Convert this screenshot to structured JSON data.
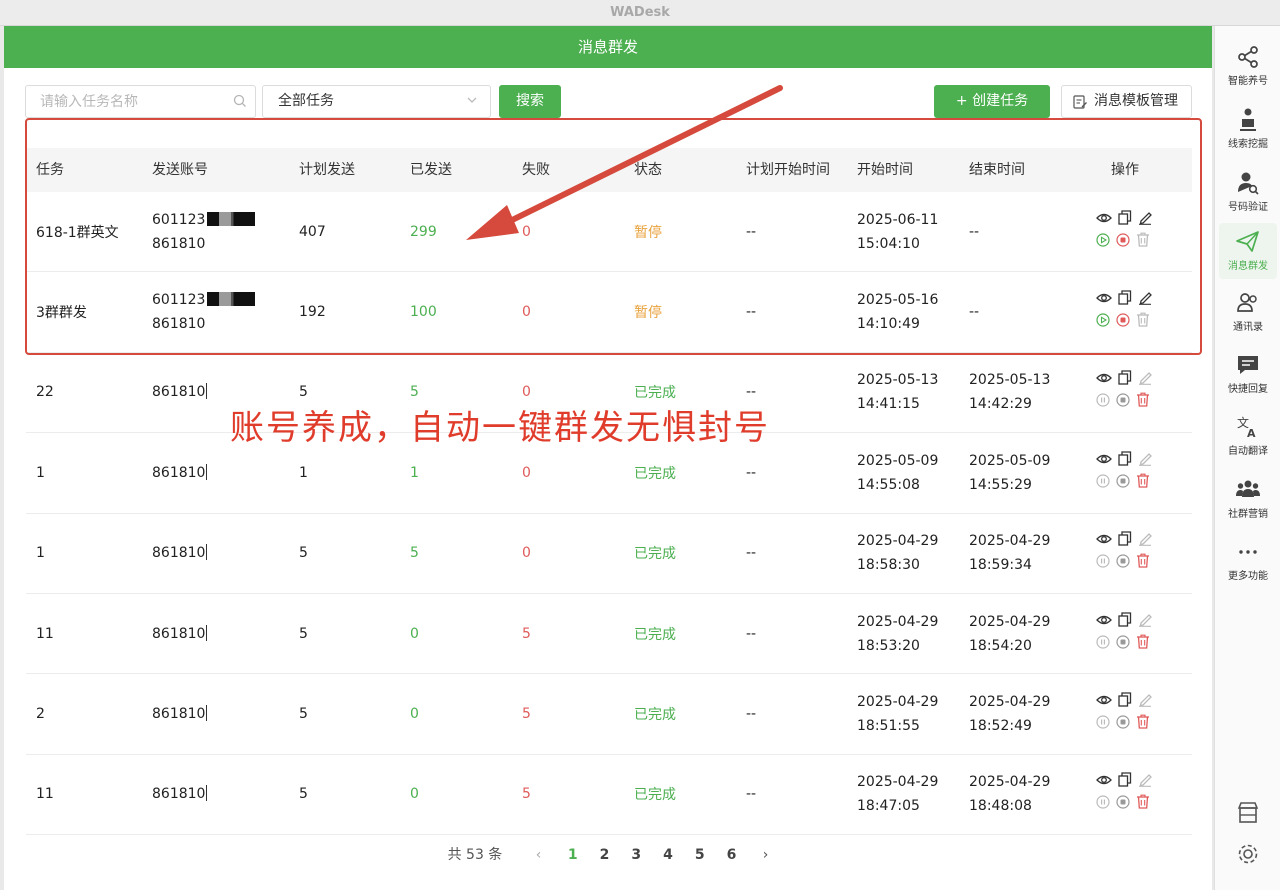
{
  "window": {
    "title": "WADesk"
  },
  "header": {
    "title": "消息群发"
  },
  "toolbar": {
    "search_placeholder": "请输入任务名称",
    "task_filter": "全部任务",
    "search_label": "搜索",
    "create_label": "+ 创建任务",
    "template_label": "消息模板管理"
  },
  "table": {
    "columns": [
      "任务",
      "发送账号",
      "计划发送",
      "已发送",
      "失败",
      "状态",
      "计划开始时间",
      "开始时间",
      "结束时间",
      "操作"
    ],
    "rows": [
      {
        "task": "618-1群英文",
        "account1": "601123",
        "account2": "861810",
        "planned": "407",
        "sent": "299",
        "failed": "0",
        "status": "暂停",
        "plan_start": "--",
        "start_date": "2025-06-11",
        "start_time": "15:04:10",
        "end_date": "--",
        "end_time": ""
      },
      {
        "task": "3群群发",
        "account1": "601123",
        "account2": "861810",
        "planned": "192",
        "sent": "100",
        "failed": "0",
        "status": "暂停",
        "plan_start": "--",
        "start_date": "2025-05-16",
        "start_time": "14:10:49",
        "end_date": "--",
        "end_time": ""
      },
      {
        "task": "22",
        "account1": "861810",
        "account2": "",
        "planned": "5",
        "sent": "5",
        "failed": "0",
        "status": "已完成",
        "plan_start": "--",
        "start_date": "2025-05-13",
        "start_time": "14:41:15",
        "end_date": "2025-05-13",
        "end_time": "14:42:29"
      },
      {
        "task": "1",
        "account1": "861810",
        "account2": "",
        "planned": "1",
        "sent": "1",
        "failed": "0",
        "status": "已完成",
        "plan_start": "--",
        "start_date": "2025-05-09",
        "start_time": "14:55:08",
        "end_date": "2025-05-09",
        "end_time": "14:55:29"
      },
      {
        "task": "1",
        "account1": "861810",
        "account2": "",
        "planned": "5",
        "sent": "5",
        "failed": "0",
        "status": "已完成",
        "plan_start": "--",
        "start_date": "2025-04-29",
        "start_time": "18:58:30",
        "end_date": "2025-04-29",
        "end_time": "18:59:34"
      },
      {
        "task": "11",
        "account1": "861810",
        "account2": "",
        "planned": "5",
        "sent": "0",
        "failed": "5",
        "status": "已完成",
        "plan_start": "--",
        "start_date": "2025-04-29",
        "start_time": "18:53:20",
        "end_date": "2025-04-29",
        "end_time": "18:54:20"
      },
      {
        "task": "2",
        "account1": "861810",
        "account2": "",
        "planned": "5",
        "sent": "0",
        "failed": "5",
        "status": "已完成",
        "plan_start": "--",
        "start_date": "2025-04-29",
        "start_time": "18:51:55",
        "end_date": "2025-04-29",
        "end_time": "18:52:49"
      },
      {
        "task": "11",
        "account1": "861810",
        "account2": "",
        "planned": "5",
        "sent": "0",
        "failed": "5",
        "status": "已完成",
        "plan_start": "--",
        "start_date": "2025-04-29",
        "start_time": "18:47:05",
        "end_date": "2025-04-29",
        "end_time": "18:48:08"
      }
    ]
  },
  "annotation": {
    "text": "账号养成，自动一键群发无惧封号"
  },
  "pagination": {
    "total": "共 53 条",
    "pages": [
      "1",
      "2",
      "3",
      "4",
      "5",
      "6"
    ],
    "active": "1"
  },
  "sidebar": {
    "items": [
      {
        "label": "智能养号",
        "icon": "share-nodes-icon"
      },
      {
        "label": "线索挖掘",
        "icon": "person-dig-icon"
      },
      {
        "label": "号码验证",
        "icon": "user-search-icon"
      },
      {
        "label": "消息群发",
        "icon": "paper-plane-icon"
      },
      {
        "label": "通讯录",
        "icon": "contacts-icon"
      },
      {
        "label": "快捷回复",
        "icon": "chat-bubble-icon"
      },
      {
        "label": "自动翻译",
        "icon": "translate-icon"
      },
      {
        "label": "社群营销",
        "icon": "group-icon"
      },
      {
        "label": "更多功能",
        "icon": "more-dots-icon"
      }
    ],
    "active": "消息群发"
  },
  "colors": {
    "brand": "#4caf50",
    "paused": "#e8a33d",
    "failed": "#e05a5a",
    "annotation": "#e03c2b"
  }
}
